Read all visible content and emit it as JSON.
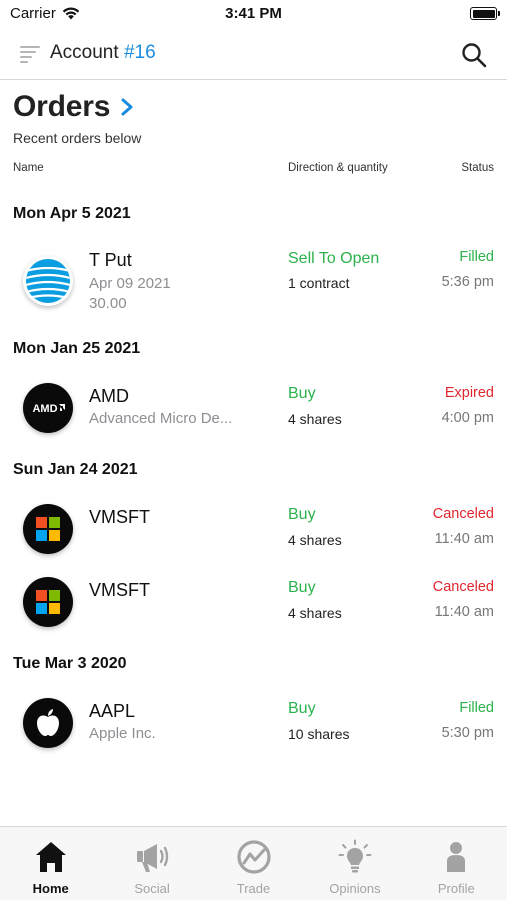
{
  "status_bar": {
    "carrier": "Carrier",
    "time": "3:41 PM"
  },
  "nav": {
    "account_label": "Account",
    "account_number": "#16",
    "accent_color": "#1a8ce0"
  },
  "header": {
    "title": "Orders",
    "subtitle": "Recent orders below",
    "columns": {
      "name": "Name",
      "direction": "Direction & quantity",
      "status": "Status"
    }
  },
  "groups": [
    {
      "date": "Mon Apr 5 2021",
      "orders": [
        {
          "logo": "att-globe-icon",
          "symbol": "T Put",
          "desc_lines": [
            "Apr 09 2021",
            "30.00"
          ],
          "direction": "Sell To Open",
          "quantity": "1 contract",
          "status": "Filled",
          "status_color": "#2bb24c",
          "time": "5:36 pm"
        }
      ]
    },
    {
      "date": "Mon Jan 25 2021",
      "orders": [
        {
          "logo": "amd-logo-icon",
          "symbol": "AMD",
          "desc_lines": [
            "Advanced Micro De..."
          ],
          "direction": "Buy",
          "quantity": "4 shares",
          "status": "Expired",
          "status_color": "#e0262f",
          "time": "4:00 pm"
        }
      ]
    },
    {
      "date": "Sun Jan 24 2021",
      "orders": [
        {
          "logo": "microsoft-logo-icon",
          "symbol": "VMSFT",
          "desc_lines": [],
          "direction": "Buy",
          "quantity": "4 shares",
          "status": "Canceled",
          "status_color": "#e0262f",
          "time": "11:40 am"
        },
        {
          "logo": "microsoft-logo-icon",
          "symbol": "VMSFT",
          "desc_lines": [],
          "direction": "Buy",
          "quantity": "4 shares",
          "status": "Canceled",
          "status_color": "#e0262f",
          "time": "11:40 am"
        }
      ]
    },
    {
      "date": "Tue Mar 3 2020",
      "orders": [
        {
          "logo": "apple-logo-icon",
          "symbol": "AAPL",
          "desc_lines": [
            "Apple Inc."
          ],
          "direction": "Buy",
          "quantity": "10 shares",
          "status": "Filled",
          "status_color": "#2bb24c",
          "time": "5:30 pm"
        }
      ]
    }
  ],
  "tabs": [
    {
      "label": "Home",
      "icon": "home-icon",
      "active": true
    },
    {
      "label": "Social",
      "icon": "megaphone-icon",
      "active": false
    },
    {
      "label": "Trade",
      "icon": "trade-chart-icon",
      "active": false
    },
    {
      "label": "Opinions",
      "icon": "lightbulb-icon",
      "active": false
    },
    {
      "label": "Profile",
      "icon": "profile-icon",
      "active": false
    }
  ],
  "colors": {
    "buy_green": "#2bb24c",
    "alert_red": "#e0262f",
    "inactive_gray": "#a3a3a3"
  }
}
